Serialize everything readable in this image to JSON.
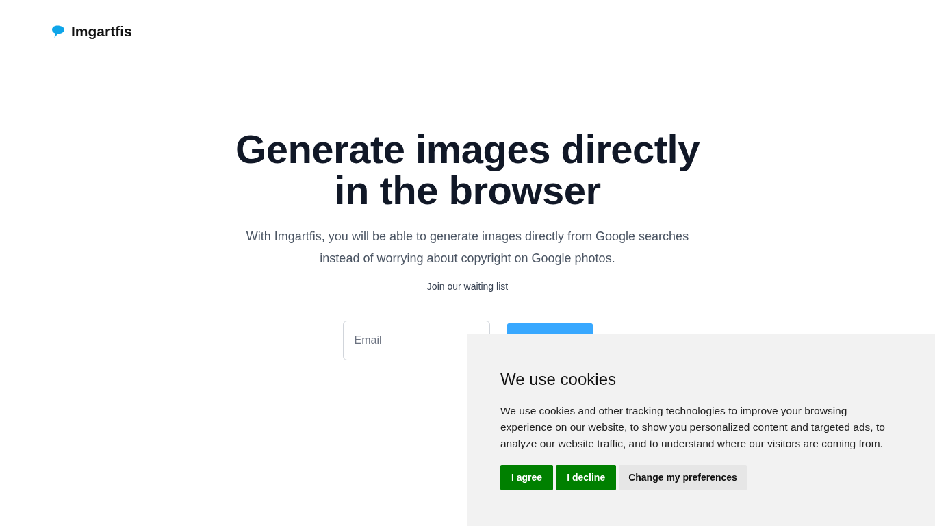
{
  "header": {
    "logo": {
      "text": "Imgartfis"
    }
  },
  "hero": {
    "title_lines": [
      "Generate images directly",
      "in the browser"
    ],
    "description": "With Imgartfis, you will be able to generate images directly from Google searches instead of worrying about copyright on Google photos.",
    "waitlist_label": "Join our waiting list",
    "email_field": {
      "placeholder": "Email"
    }
  },
  "cookie_banner": {
    "title": "We use cookies",
    "message": "We use cookies and other tracking technologies to improve your browsing experience on our website, to show you personalized content and targeted ads, to analyze our website traffic, and to understand where our visitors are coming from.",
    "buttons": [
      {
        "label": "I agree",
        "kind": "primary"
      },
      {
        "label": "I decline",
        "kind": "primary"
      },
      {
        "label": "Change my preferences",
        "kind": "secondary"
      }
    ]
  }
}
